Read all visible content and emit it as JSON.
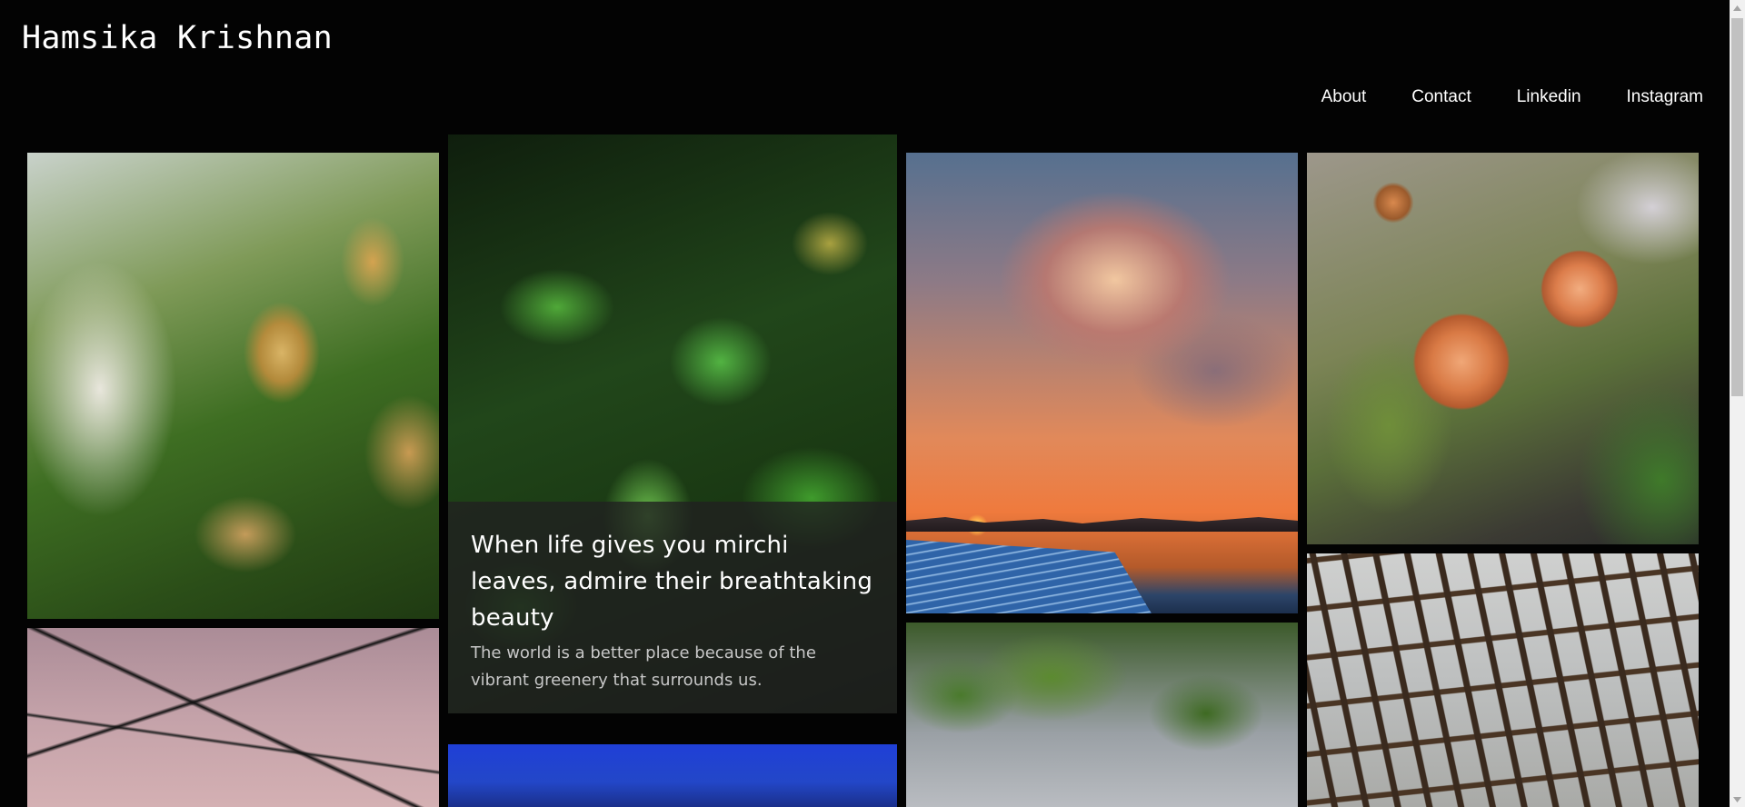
{
  "site": {
    "title": "Hamsika Krishnan"
  },
  "nav": {
    "items": [
      "About",
      "Contact",
      "Linkedin",
      "Instagram"
    ]
  },
  "featured": {
    "title": "When life gives you mirchi leaves, admire their breathtaking beauty",
    "text": "The world is a better place because of the vibrant greenery that surrounds us."
  },
  "icons": {
    "scroll_up": "chevron-up-icon",
    "scroll_down": "chevron-down-icon"
  }
}
